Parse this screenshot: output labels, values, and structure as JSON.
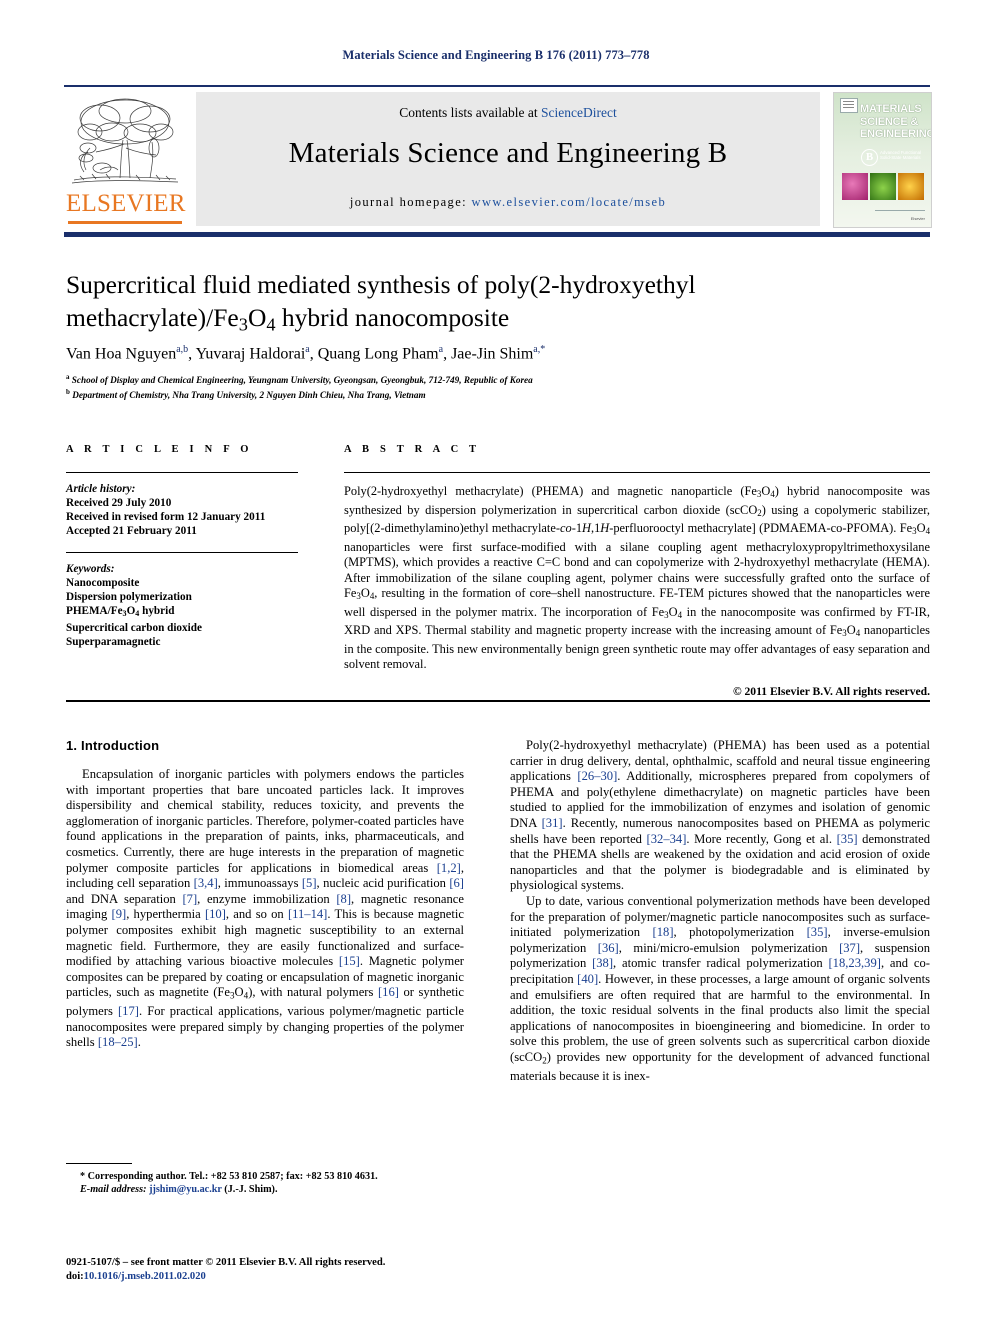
{
  "running_head": "Materials Science and Engineering B 176 (2011) 773–778",
  "journal_header": {
    "contents_prefix": "Contents lists available at ",
    "contents_link": "ScienceDirect",
    "journal_title": "Materials Science and Engineering B",
    "homepage_label": "journal homepage:",
    "homepage_url": "www.elsevier.com/locate/mseb",
    "publisher_logo_text": "ELSEVIER",
    "accent_orange": "#E87722",
    "link_blue": "#1c4f9c",
    "rule_navy": "#1a2f6b"
  },
  "cover": {
    "line1": "MATERIALS",
    "line2": "SCIENCE &",
    "line3": "ENGINEERING",
    "badge": "B",
    "subtitle": "Advanced Functional Solid-State Materials",
    "footer": "Elsevier"
  },
  "article": {
    "title_line1": "Supercritical fluid mediated synthesis of poly(2-hydroxyethyl",
    "title_line2_a": "methacrylate)/Fe",
    "title_line2_sub1": "3",
    "title_line2_b": "O",
    "title_line2_sub2": "4",
    "title_line2_c": " hybrid nanocomposite",
    "authors": [
      {
        "name": "Van Hoa Nguyen",
        "marks": "a,b"
      },
      {
        "name": "Yuvaraj Haldorai",
        "marks": "a"
      },
      {
        "name": "Quang Long Pham",
        "marks": "a"
      },
      {
        "name": "Jae-Jin Shim",
        "marks": "a,*"
      }
    ],
    "affiliation_a": "School of Display and Chemical Engineering, Yeungnam University, Gyeongsan, Gyeongbuk, 712-749, Republic of Korea",
    "affiliation_b": "Department of Chemistry, Nha Trang University, 2 Nguyen Dinh Chieu, Nha Trang, Vietnam"
  },
  "article_info": {
    "heading": "A R T I C L E    I N F O",
    "history_label": "Article history:",
    "history": [
      "Received 29 July 2010",
      "Received in revised form 12 January 2011",
      "Accepted 21 February 2011"
    ],
    "keywords_label": "Keywords:",
    "keywords": [
      "Nanocomposite",
      "Dispersion polymerization",
      "PHEMA/Fe3O4 hybrid",
      "Supercritical carbon dioxide",
      "Superparamagnetic"
    ]
  },
  "abstract": {
    "heading": "A B S T R A C T",
    "copyright": "© 2011 Elsevier B.V. All rights reserved."
  },
  "sections": {
    "introduction_heading": "1.  Introduction"
  },
  "footnote": {
    "corresponding": "* Corresponding author. Tel.: +82 53 810 2587; fax: +82 53 810 4631.",
    "email_label": "E-mail address:",
    "email": "jjshim@yu.ac.kr",
    "email_owner": "(J.-J. Shim)."
  },
  "imprint": {
    "line1": "0921-5107/$ – see front matter © 2011 Elsevier B.V. All rights reserved.",
    "doi_label": "doi:",
    "doi": "10.1016/j.mseb.2011.02.020"
  }
}
